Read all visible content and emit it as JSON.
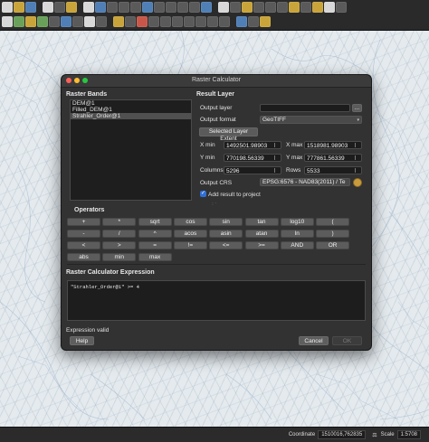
{
  "dialog": {
    "title": "Raster Calculator",
    "raster_bands": {
      "heading": "Raster Bands",
      "items": [
        "DEM@1",
        "Filled_DEM@1",
        "Strahler_Order@1"
      ],
      "selected_index": 2
    },
    "result_layer": {
      "heading": "Result Layer",
      "output_layer_label": "Output layer",
      "output_layer_value": "",
      "browse_label": "...",
      "output_format_label": "Output format",
      "output_format_value": "GeoTIFF",
      "selected_extent_button": "Selected Layer Extent",
      "xmin_label": "X min",
      "xmin_value": "1492501.98903",
      "xmax_label": "X max",
      "xmax_value": "1518981.98903",
      "ymin_label": "Y min",
      "ymin_value": "770198.56339",
      "ymax_label": "Y max",
      "ymax_value": "777861.56339",
      "columns_label": "Columns",
      "columns_value": "5296",
      "rows_label": "Rows",
      "rows_value": "5533",
      "output_crs_label": "Output CRS",
      "output_crs_value": "EPSG:6576 - NAD83(2011) / Te",
      "add_to_project_label": "Add result to project",
      "add_to_project_checked": true
    },
    "operators": {
      "heading": "Operators",
      "rows": [
        [
          "+",
          "*",
          "sqrt",
          "cos",
          "sin",
          "tan",
          "log10",
          "("
        ],
        [
          "-",
          "/",
          "^",
          "acos",
          "asin",
          "atan",
          "ln",
          ")"
        ],
        [
          "<",
          ">",
          "=",
          "!=",
          "<=",
          ">=",
          "AND",
          "OR"
        ],
        [
          "abs",
          "min",
          "max"
        ]
      ]
    },
    "expression": {
      "heading": "Raster Calculator Expression",
      "value": "\"Strahler_Order@1\" >= 4",
      "status": "Expression valid"
    },
    "buttons": {
      "help": "Help",
      "cancel": "Cancel",
      "ok": "OK"
    }
  },
  "statusbar": {
    "coordinate_label": "Coordinate",
    "coordinate_value": "1510016,762835",
    "scale_label": "Scale",
    "scale_value": "1:5708"
  },
  "colors": {
    "dialog_bg": "#323232",
    "accent_checkbox": "#2f6fd6",
    "close_button": "#ff5f57",
    "minimize_button": "#febc2e",
    "zoom_button": "#28c840"
  }
}
